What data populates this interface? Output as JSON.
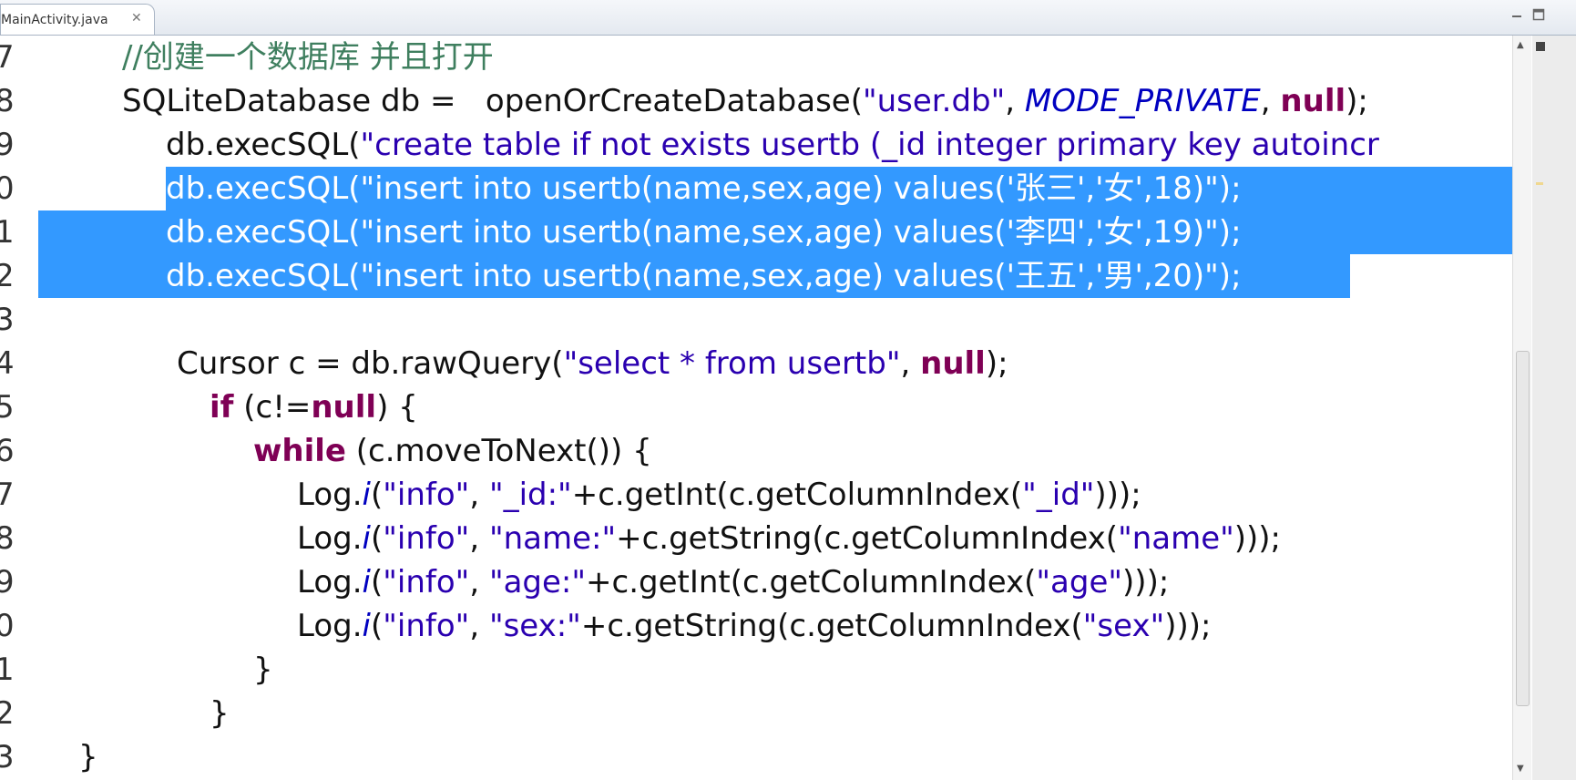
{
  "tab": {
    "title": "MainActivity.java",
    "close_glyph": "✕"
  },
  "lines": [
    {
      "num": "7"
    },
    {
      "num": "8"
    },
    {
      "num": "9"
    },
    {
      "num": "0"
    },
    {
      "num": "1"
    },
    {
      "num": "2"
    },
    {
      "num": "3"
    },
    {
      "num": "4"
    },
    {
      "num": "5"
    },
    {
      "num": "6"
    },
    {
      "num": "7"
    },
    {
      "num": "8"
    },
    {
      "num": "9"
    },
    {
      "num": "0"
    },
    {
      "num": "1"
    },
    {
      "num": "2"
    },
    {
      "num": "3"
    }
  ],
  "code": {
    "l7_comment": "//创建一个数据库 并且打开",
    "l8_a": "SQLiteDatabase db =   openOrCreateDatabase(",
    "l8_str": "\"user.db\"",
    "l8_b": ", ",
    "l8_const": "MODE_PRIVATE",
    "l8_c": ", ",
    "l8_kw": "null",
    "l8_d": ");",
    "l9_a": "db.execSQL(",
    "l9_str": "\"create table if not exists usertb (_id integer primary key autoincr",
    "l10": "db.execSQL(\"insert into usertb(name,sex,age) values('张三','女',18)\");",
    "l11": "db.execSQL(\"insert into usertb(name,sex,age) values('李四','女',19)\");",
    "l12": "db.execSQL(\"insert into usertb(name,sex,age) values('王五','男',20)\");",
    "l14_a": "Cursor c = db.rawQuery(",
    "l14_str": "\"select * from usertb\"",
    "l14_b": ", ",
    "l14_kw": "null",
    "l14_c": ");",
    "l15_kw": "if",
    "l15_a": " (c!=",
    "l15_kw2": "null",
    "l15_b": ") {",
    "l16_kw": "while",
    "l16_a": " (c.moveToNext()) {",
    "l17_a": "Log.",
    "l17_i": "i",
    "l17_b": "(",
    "l17_s1": "\"info\"",
    "l17_c": ", ",
    "l17_s2": "\"_id:\"",
    "l17_d": "+c.getInt(c.getColumnIndex(",
    "l17_s3": "\"_id\"",
    "l17_e": ")));",
    "l18_s2": "\"name:\"",
    "l18_d": "+c.getString(c.getColumnIndex(",
    "l18_s3": "\"name\"",
    "l19_s2": "\"age:\"",
    "l19_d": "+c.getInt(c.getColumnIndex(",
    "l19_s3": "\"age\"",
    "l20_s2": "\"sex:\"",
    "l20_d": "+c.getString(c.getColumnIndex(",
    "l20_s3": "\"sex\"",
    "brace_close": "}"
  },
  "colors": {
    "selection": "#3399ff",
    "keyword": "#7f0055",
    "string": "#2a00b0",
    "comment": "#3f7f5f"
  },
  "icons": {
    "minimize": "minimize-icon",
    "maximize": "maximize-icon",
    "scroll_up": "▲",
    "scroll_down": "▼"
  }
}
